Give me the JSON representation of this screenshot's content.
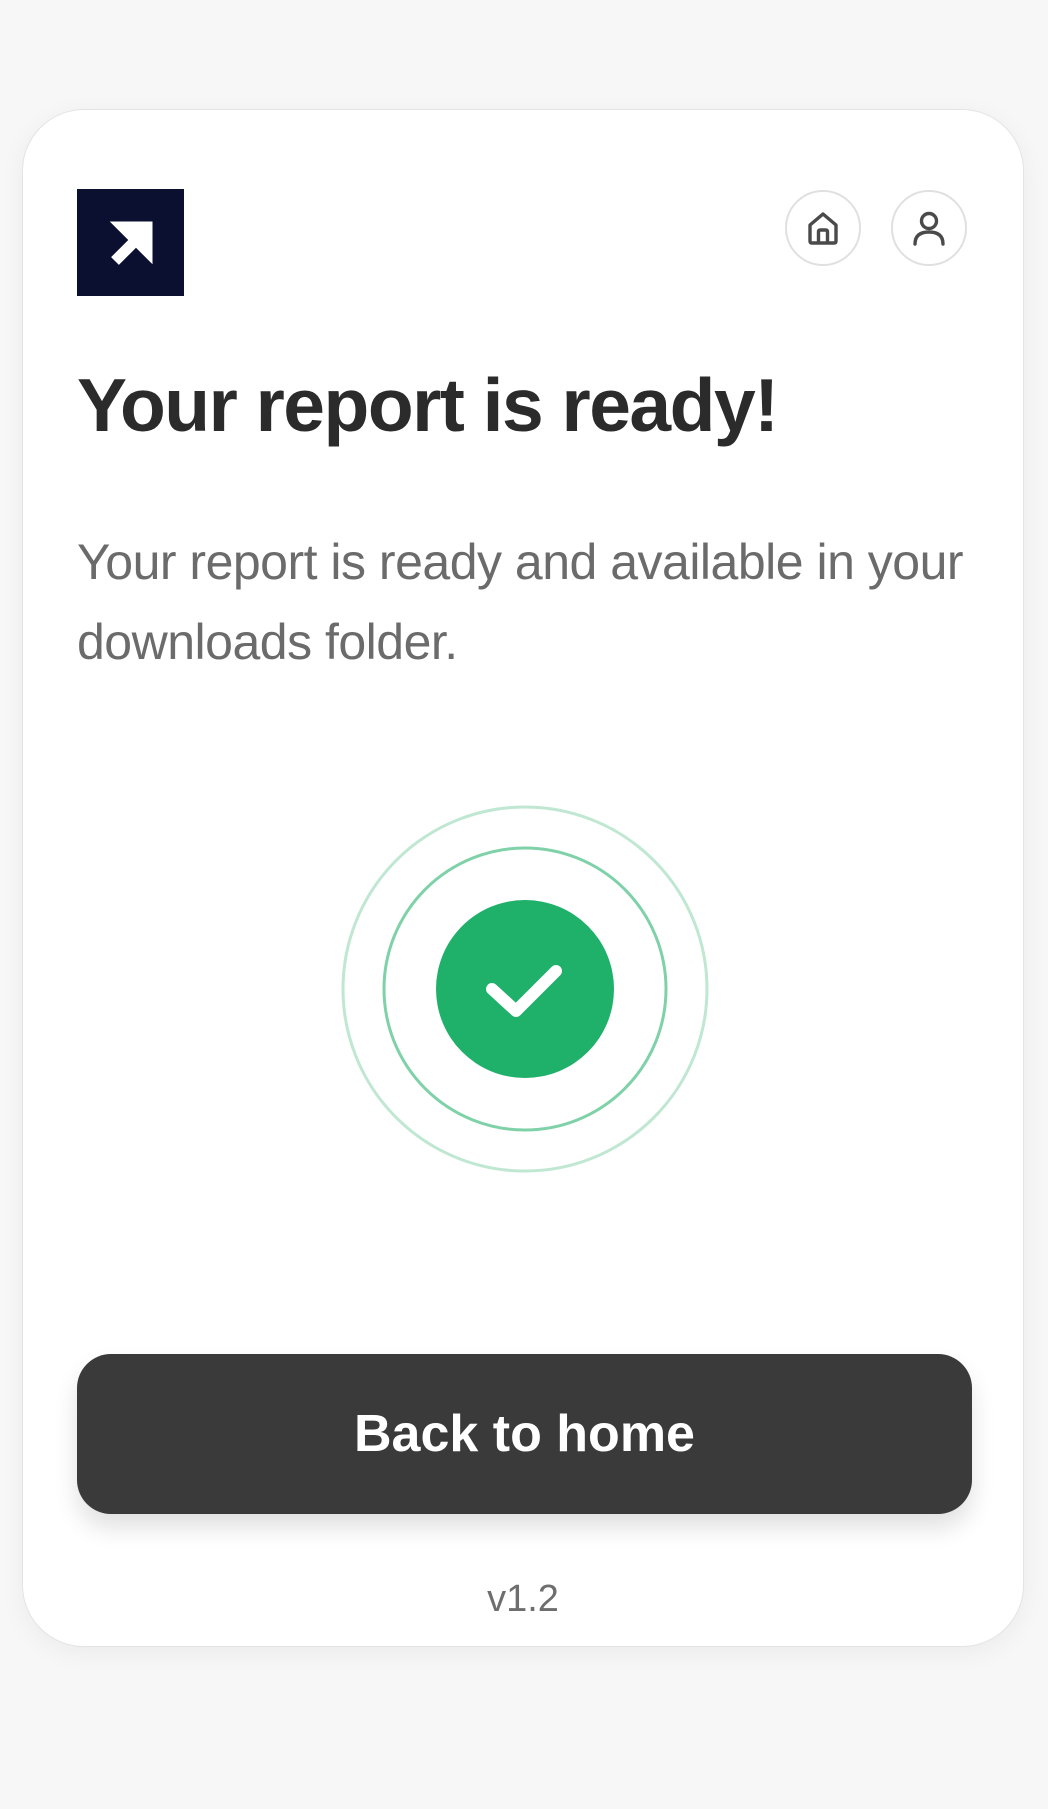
{
  "header": {
    "logo_icon": "arrow-up-right-icon",
    "home_icon": "home-icon",
    "profile_icon": "user-icon"
  },
  "content": {
    "title": "Your report is ready!",
    "description": "Your report is ready and available in your downloads folder."
  },
  "status": {
    "icon": "check-circle-icon",
    "color": "#1fb06a",
    "ring_color": "#7fd1a8"
  },
  "actions": {
    "back_home_label": "Back to home"
  },
  "footer": {
    "version": "v1.2"
  },
  "colors": {
    "logo_bg": "#0b1030",
    "button_bg": "#3a3a3a"
  }
}
